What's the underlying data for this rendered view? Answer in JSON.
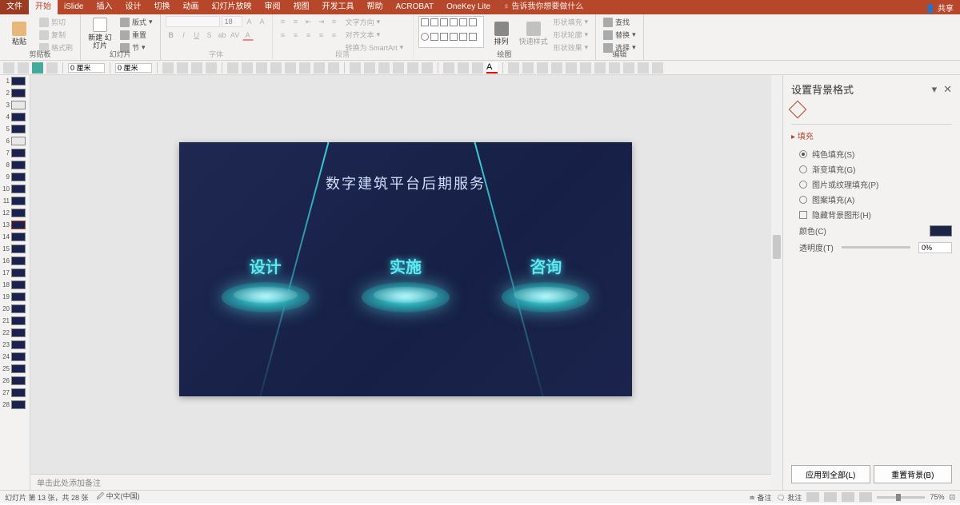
{
  "titlebar": {
    "tabs": [
      "文件",
      "开始",
      "iSlide",
      "插入",
      "设计",
      "切换",
      "动画",
      "幻灯片放映",
      "审阅",
      "视图",
      "开发工具",
      "帮助",
      "ACROBAT",
      "OneKey Lite"
    ],
    "active_tab_index": 1,
    "tell_me_prefix": "♀",
    "tell_me": "告诉我你想要做什么",
    "share": "共享"
  },
  "ribbon": {
    "clipboard": {
      "paste": "粘贴",
      "cut": "剪切",
      "copy": "复制",
      "painter": "格式刷",
      "label": "剪贴板"
    },
    "slides": {
      "new": "新建\n幻灯片",
      "layout": "版式",
      "reset": "重置",
      "section": "节",
      "label": "幻灯片"
    },
    "font": {
      "size": "18",
      "label": "字体"
    },
    "paragraph": {
      "dir": "文字方向",
      "align": "对齐文本",
      "smart": "转换为 SmartArt",
      "label": "段落"
    },
    "drawing": {
      "arrange": "排列",
      "quick": "快速样式",
      "fill": "形状填充",
      "outline": "形状轮廓",
      "effects": "形状效果",
      "label": "绘图"
    },
    "editing": {
      "find": "查找",
      "replace": "替换",
      "select": "选择",
      "label": "编辑"
    }
  },
  "toolbar2": {
    "val1": "0 厘米",
    "val2": "0 厘米"
  },
  "thumbnails": {
    "count": 28,
    "active": 13
  },
  "slide": {
    "title": "数字建筑平台后期服务",
    "items": [
      "设计",
      "实施",
      "咨询"
    ]
  },
  "notes": {
    "placeholder": "单击此处添加备注"
  },
  "pane": {
    "title": "设置背景格式",
    "section": "填充",
    "opts": {
      "solid": "纯色填充(S)",
      "gradient": "渐变填充(G)",
      "picture": "图片或纹理填充(P)",
      "pattern": "图案填充(A)",
      "hide": "隐藏背景图形(H)"
    },
    "color_label": "颜色(C)",
    "transparency_label": "透明度(T)",
    "transparency_value": "0%",
    "apply_all": "应用到全部(L)",
    "reset": "重置背景(B)"
  },
  "status": {
    "slide_info": "幻灯片 第 13 张，共 28 张",
    "lang": "中文(中国)",
    "notes_btn": "备注",
    "comments_btn": "批注",
    "zoom": "75%"
  }
}
